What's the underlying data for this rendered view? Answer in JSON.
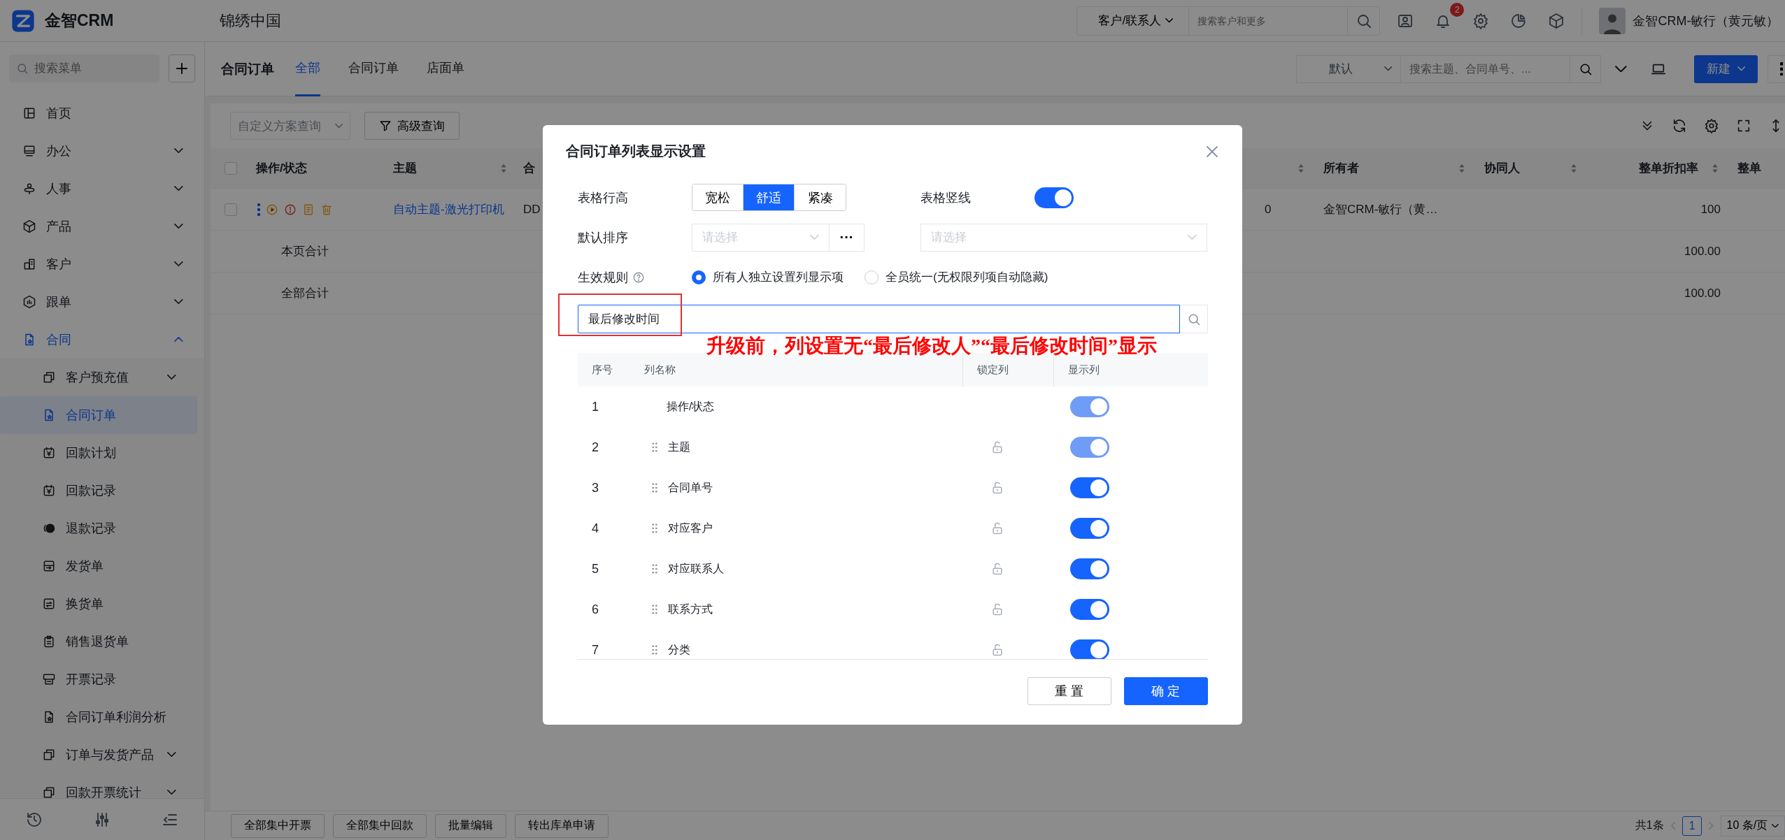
{
  "top_bar": {
    "brand": "金智CRM",
    "company": "锦绣中国",
    "search_scope": "客户/联系人",
    "search": {
      "placeholder": "搜索客户和更多"
    },
    "notification_count": "2",
    "user_name": "金智CRM-敏行（黄元敏）"
  },
  "sidebar": {
    "search": {
      "placeholder": "搜索菜单"
    },
    "items": [
      {
        "label": "首页",
        "selected": false
      },
      {
        "label": "办公",
        "selected": false,
        "expanded": false
      },
      {
        "label": "人事",
        "selected": false,
        "expanded": false
      },
      {
        "label": "产品",
        "selected": false,
        "expanded": false
      },
      {
        "label": "客户",
        "selected": false,
        "expanded": false
      },
      {
        "label": "跟单",
        "selected": false,
        "expanded": false
      },
      {
        "label": "合同",
        "selected": false,
        "expanded": true,
        "children": [
          {
            "label": "客户预充值",
            "selected": false,
            "expanded": false
          },
          {
            "label": "合同订单",
            "selected": true
          },
          {
            "label": "回款计划",
            "selected": false
          },
          {
            "label": "回款记录",
            "selected": false
          },
          {
            "label": "退款记录",
            "selected": false
          },
          {
            "label": "发货单",
            "selected": false
          },
          {
            "label": "换货单",
            "selected": false
          },
          {
            "label": "销售退货单",
            "selected": false
          },
          {
            "label": "开票记录",
            "selected": false
          },
          {
            "label": "合同订单利润分析",
            "selected": false
          },
          {
            "label": "订单与发货产品",
            "selected": false,
            "expanded": false
          },
          {
            "label": "回款开票统计",
            "selected": false,
            "expanded": false
          }
        ]
      }
    ]
  },
  "page": {
    "title": "合同订单",
    "tabs": [
      {
        "label": "全部",
        "selected": true
      },
      {
        "label": "合同订单",
        "selected": false
      },
      {
        "label": "店面单",
        "selected": false
      }
    ],
    "view_select": "默认",
    "search": {
      "placeholder": "搜索主题、合同单号、..."
    },
    "new_button": "新建"
  },
  "toolbar": {
    "scheme_select": {
      "placeholder": "自定义方案查询"
    },
    "advanced_query": "高级查询"
  },
  "table": {
    "header_checked": false,
    "columns": [
      {
        "label": "操作/状态",
        "sortable": false
      },
      {
        "label": "主题",
        "sortable": true
      },
      {
        "label": "合",
        "sortable": false
      },
      {
        "sortable": true
      },
      {
        "label": "所有者",
        "sortable": true
      },
      {
        "label": "协同人",
        "sortable": true
      },
      {
        "label": "整单折扣率",
        "sortable": true
      },
      {
        "label": "整单",
        "sortable": false
      }
    ],
    "rows": [
      {
        "kind": "data",
        "checked": false,
        "cells": [
          null,
          "自动主题-激光打印机",
          "DD",
          "0",
          "金智CRM-敏行（黄…",
          null,
          "100",
          null
        ]
      },
      {
        "kind": "summary",
        "cells": [
          "本页合计",
          null,
          null,
          null,
          null,
          null,
          "100.00",
          null
        ]
      },
      {
        "kind": "summary",
        "cells": [
          "全部合计",
          null,
          null,
          null,
          null,
          null,
          "100.00",
          null
        ]
      }
    ]
  },
  "bulk_actions": [
    "全部集中开票",
    "全部集中回款",
    "批量编辑",
    "转出库单申请"
  ],
  "pagination": {
    "total": "共1条",
    "pages": [
      {
        "label": "1",
        "selected": true
      }
    ],
    "page_size": "10 条/页"
  },
  "dialog": {
    "title": "合同订单列表显示设置",
    "row_height": {
      "label": "表格行高",
      "options": [
        {
          "label": "宽松",
          "selected": false
        },
        {
          "label": "舒适",
          "selected": true
        },
        {
          "label": "紧凑",
          "selected": false
        }
      ]
    },
    "vertical_lines": {
      "label": "表格竖线",
      "on": true
    },
    "default_sort": {
      "label": "默认排序",
      "field": {
        "placeholder": "请选择"
      },
      "more": "···",
      "order": {
        "placeholder": "请选择"
      }
    },
    "rule": {
      "label": "生效规则",
      "options": [
        {
          "label": "所有人独立设置列显示项",
          "selected": true
        },
        {
          "label": "全员统一(无权限列项自动隐藏)",
          "selected": false
        }
      ]
    },
    "search": {
      "value": "最后修改时间"
    },
    "columns_table": {
      "headers": [
        "序号",
        "列名称",
        "锁定列",
        "显示列"
      ],
      "rows": [
        {
          "index": "1",
          "name": "操作/状态",
          "draggable": false,
          "shown": true,
          "disabled": true
        },
        {
          "index": "2",
          "name": "主题",
          "draggable": true,
          "locked": false,
          "shown": true,
          "disabled": true
        },
        {
          "index": "3",
          "name": "合同单号",
          "draggable": true,
          "locked": false,
          "shown": true,
          "disabled": false
        },
        {
          "index": "4",
          "name": "对应客户",
          "draggable": true,
          "locked": false,
          "shown": true,
          "disabled": false
        },
        {
          "index": "5",
          "name": "对应联系人",
          "draggable": true,
          "locked": false,
          "shown": true,
          "disabled": false
        },
        {
          "index": "6",
          "name": "联系方式",
          "draggable": true,
          "locked": false,
          "shown": true,
          "disabled": false
        },
        {
          "index": "7",
          "name": "分类",
          "draggable": true,
          "locked": false,
          "shown": true,
          "disabled": false
        }
      ]
    },
    "buttons": {
      "reset": "重 置",
      "confirm": "确 定"
    },
    "annotation": "升级前，列设置无“最后修改人”“最后修改时间”显示"
  }
}
